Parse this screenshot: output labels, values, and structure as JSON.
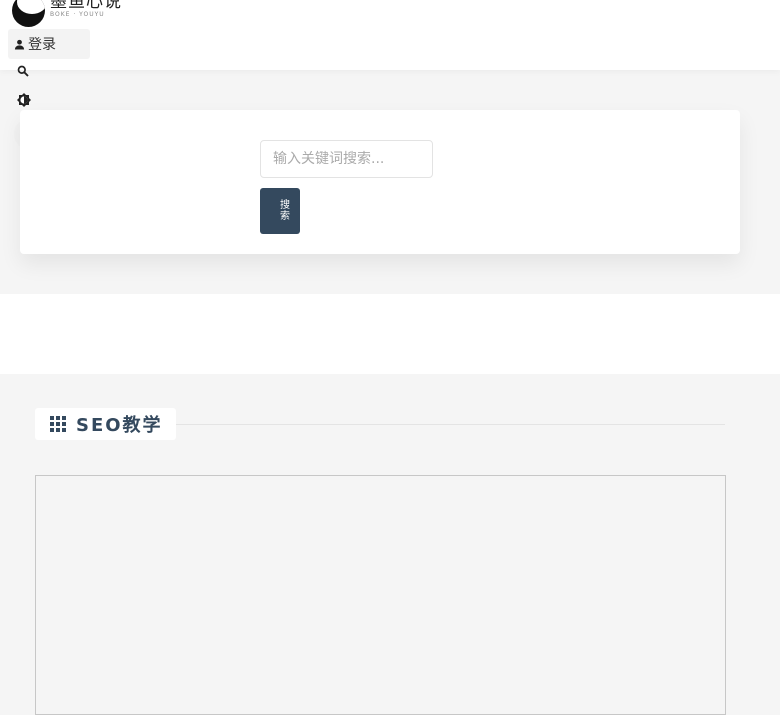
{
  "header": {
    "logo": {
      "title": "墨鱼心说",
      "subtitle": "BOKE · YOUYU"
    },
    "login_label": "登录",
    "icons": {
      "user": "user-icon",
      "search": "search-icon",
      "theme": "theme-toggle-icon",
      "menu": "menu-icon"
    }
  },
  "search": {
    "placeholder": "输入关键词搜索...",
    "value": "",
    "button_label": "搜索"
  },
  "section": {
    "icon": "grid-icon",
    "title": "SEO教学"
  },
  "colors": {
    "accent": "#34495e",
    "page_bg": "#f5f5f5",
    "card_bg": "#ffffff"
  }
}
